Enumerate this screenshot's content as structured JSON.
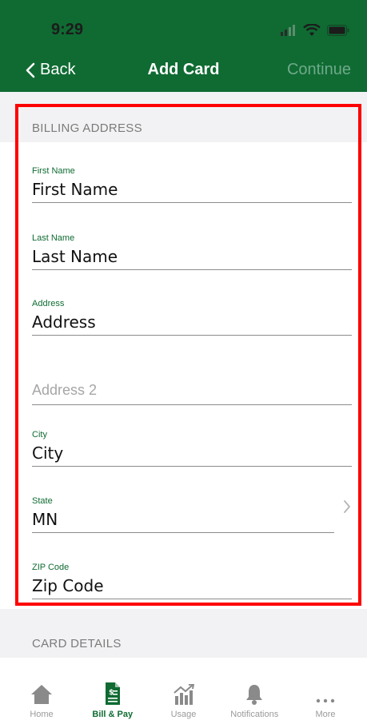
{
  "status_bar": {
    "time": "9:29"
  },
  "nav": {
    "back_label": "Back",
    "title": "Add Card",
    "continue_label": "Continue"
  },
  "billing": {
    "section_title": "BILLING ADDRESS",
    "fields": [
      {
        "label": "First Name",
        "value": "First Name"
      },
      {
        "label": "Last Name",
        "value": "Last Name"
      },
      {
        "label": "Address",
        "value": "Address"
      },
      {
        "label": "",
        "value": "Address 2"
      },
      {
        "label": "City",
        "value": "City"
      },
      {
        "label": "State",
        "value": "MN"
      },
      {
        "label": "ZIP Code",
        "value": "Zip Code"
      }
    ]
  },
  "card_details": {
    "section_title": "CARD DETAILS"
  },
  "tabbar": {
    "items": [
      {
        "label": "Home",
        "icon": "home-icon"
      },
      {
        "label": "Bill & Pay",
        "icon": "bill-icon"
      },
      {
        "label": "Usage",
        "icon": "usage-chart-icon"
      },
      {
        "label": "Notifications",
        "icon": "bell-icon"
      },
      {
        "label": "More",
        "icon": "more-dots-icon"
      }
    ],
    "active_index": 1
  },
  "colors": {
    "brand": "#0f6b32",
    "highlight": "#ff0000"
  }
}
